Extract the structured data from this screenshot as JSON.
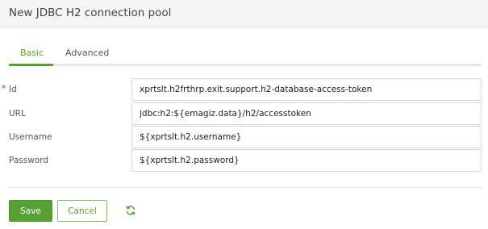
{
  "header": {
    "title": "New JDBC H2 connection pool"
  },
  "tabs": [
    {
      "label": "Basic",
      "active": true
    },
    {
      "label": "Advanced",
      "active": false
    }
  ],
  "form": {
    "required_marker": "*",
    "id": {
      "label": "Id",
      "value": "xprtslt.h2frthrp.exit.support.h2-database-access-token",
      "required": true
    },
    "url": {
      "label": "URL",
      "value": "jdbc:h2:${emagiz.data}/h2/accesstoken"
    },
    "username": {
      "label": "Username",
      "value": "${xprtslt.h2.username}"
    },
    "password": {
      "label": "Password",
      "value": "${xprtslt.h2.password}"
    }
  },
  "actions": {
    "save_label": "Save",
    "cancel_label": "Cancel",
    "refresh_icon": "refresh-icon"
  },
  "colors": {
    "accent": "#5aa134",
    "required": "#c0392b"
  }
}
